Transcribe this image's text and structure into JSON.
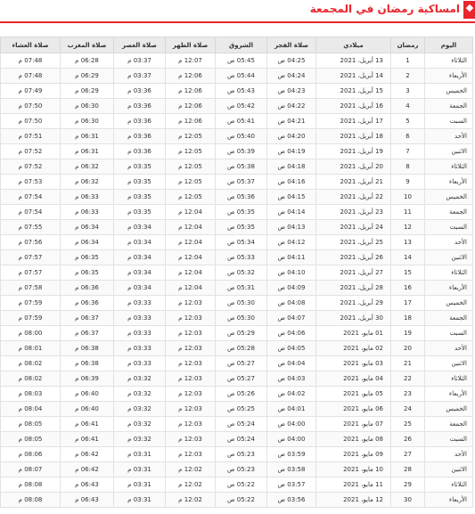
{
  "header": {
    "title": "امساكية رمضان في المجمعة",
    "flag_color": "#e9262c"
  },
  "table": {
    "columns": [
      "اليوم",
      "رمضان",
      "ميلادي",
      "صلاة الفجر",
      "الشروق",
      "صلاة الظهر",
      "صلاة العصر",
      "صلاة المغرب",
      "صلاة العشاء"
    ],
    "rows": [
      [
        "الثلاثاء",
        "1",
        "13 أبريل، 2021",
        "04:25 ص",
        "05:45 ص",
        "12:07 م",
        "03:37 م",
        "06:28 م",
        "07:48 م"
      ],
      [
        "الأربعاء",
        "2",
        "14 أبريل، 2021",
        "04:24 ص",
        "05:44 ص",
        "12:06 م",
        "03:37 م",
        "06:29 م",
        "07:48 م"
      ],
      [
        "الخميس",
        "3",
        "15 أبريل، 2021",
        "04:23 ص",
        "05:43 ص",
        "12:06 م",
        "03:36 م",
        "06:29 م",
        "07:49 م"
      ],
      [
        "الجمعة",
        "4",
        "16 أبريل، 2021",
        "04:22 ص",
        "05:42 ص",
        "12:06 م",
        "03:36 م",
        "06:30 م",
        "07:50 م"
      ],
      [
        "السبت",
        "5",
        "17 أبريل، 2021",
        "04:21 ص",
        "05:41 ص",
        "12:06 م",
        "03:36 م",
        "06:30 م",
        "07:50 م"
      ],
      [
        "الأحد",
        "6",
        "18 أبريل، 2021",
        "04:20 ص",
        "05:40 ص",
        "12:05 م",
        "03:36 م",
        "06:31 م",
        "07:51 م"
      ],
      [
        "الاثنين",
        "7",
        "19 أبريل، 2021",
        "04:19 ص",
        "05:39 ص",
        "12:05 م",
        "03:36 م",
        "06:31 م",
        "07:52 م"
      ],
      [
        "الثلاثاء",
        "8",
        "20 أبريل، 2021",
        "04:18 ص",
        "05:38 ص",
        "12:05 م",
        "03:35 م",
        "06:32 م",
        "07:52 م"
      ],
      [
        "الأربعاء",
        "9",
        "21 أبريل، 2021",
        "04:16 ص",
        "05:37 ص",
        "12:05 م",
        "03:35 م",
        "06:32 م",
        "07:53 م"
      ],
      [
        "الخميس",
        "10",
        "22 أبريل، 2021",
        "04:15 ص",
        "05:36 ص",
        "12:05 م",
        "03:35 م",
        "06:33 م",
        "07:54 م"
      ],
      [
        "الجمعة",
        "11",
        "23 أبريل، 2021",
        "04:14 ص",
        "05:35 ص",
        "12:04 م",
        "03:35 م",
        "06:33 م",
        "07:54 م"
      ],
      [
        "السبت",
        "12",
        "24 أبريل، 2021",
        "04:13 ص",
        "05:35 ص",
        "12:04 م",
        "03:34 م",
        "06:34 م",
        "07:55 م"
      ],
      [
        "الأحد",
        "13",
        "25 أبريل، 2021",
        "04:12 ص",
        "05:34 ص",
        "12:04 م",
        "03:34 م",
        "06:34 م",
        "07:56 م"
      ],
      [
        "الاثنين",
        "14",
        "26 أبريل، 2021",
        "04:11 ص",
        "05:33 ص",
        "12:04 م",
        "03:34 م",
        "06:35 م",
        "07:57 م"
      ],
      [
        "الثلاثاء",
        "15",
        "27 أبريل، 2021",
        "04:10 ص",
        "05:32 ص",
        "12:04 م",
        "03:34 م",
        "06:35 م",
        "07:57 م"
      ],
      [
        "الأربعاء",
        "16",
        "28 أبريل، 2021",
        "04:09 ص",
        "05:31 ص",
        "12:04 م",
        "03:34 م",
        "06:36 م",
        "07:58 م"
      ],
      [
        "الخميس",
        "17",
        "29 أبريل، 2021",
        "04:08 ص",
        "05:30 ص",
        "12:03 م",
        "03:33 م",
        "06:36 م",
        "07:59 م"
      ],
      [
        "الجمعة",
        "18",
        "30 أبريل، 2021",
        "04:07 ص",
        "05:30 ص",
        "12:03 م",
        "03:33 م",
        "06:37 م",
        "07:59 م"
      ],
      [
        "السبت",
        "19",
        "01 مايو، 2021",
        "04:06 ص",
        "05:29 ص",
        "12:03 م",
        "03:33 م",
        "06:37 م",
        "08:00 م"
      ],
      [
        "الأحد",
        "20",
        "02 مايو، 2021",
        "04:05 ص",
        "05:28 ص",
        "12:03 م",
        "03:33 م",
        "06:38 م",
        "08:01 م"
      ],
      [
        "الاثنين",
        "21",
        "03 مايو، 2021",
        "04:04 ص",
        "05:27 ص",
        "12:03 م",
        "03:33 م",
        "06:38 م",
        "08:02 م"
      ],
      [
        "الثلاثاء",
        "22",
        "04 مايو، 2021",
        "04:03 ص",
        "05:27 ص",
        "12:03 م",
        "03:32 م",
        "06:39 م",
        "08:02 م"
      ],
      [
        "الأربعاء",
        "23",
        "05 مايو، 2021",
        "04:02 ص",
        "05:26 ص",
        "12:03 م",
        "03:32 م",
        "06:40 م",
        "08:03 م"
      ],
      [
        "الخميس",
        "24",
        "06 مايو، 2021",
        "04:01 ص",
        "05:25 ص",
        "12:03 م",
        "03:32 م",
        "06:40 م",
        "08:04 م"
      ],
      [
        "الجمعة",
        "25",
        "07 مايو، 2021",
        "04:00 ص",
        "05:24 ص",
        "12:03 م",
        "03:32 م",
        "06:41 م",
        "08:05 م"
      ],
      [
        "السبت",
        "26",
        "08 مايو، 2021",
        "04:00 ص",
        "05:24 ص",
        "12:03 م",
        "03:32 م",
        "06:41 م",
        "08:05 م"
      ],
      [
        "الأحد",
        "27",
        "09 مايو، 2021",
        "03:59 ص",
        "05:23 ص",
        "12:03 م",
        "03:31 م",
        "06:42 م",
        "08:06 م"
      ],
      [
        "الاثنين",
        "28",
        "10 مايو، 2021",
        "03:58 ص",
        "05:23 ص",
        "12:02 م",
        "03:31 م",
        "06:42 م",
        "08:07 م"
      ],
      [
        "الثلاثاء",
        "29",
        "11 مايو، 2021",
        "03:57 ص",
        "05:22 ص",
        "12:02 م",
        "03:31 م",
        "06:43 م",
        "08:08 م"
      ],
      [
        "الأربعاء",
        "30",
        "12 مايو، 2021",
        "03:56 ص",
        "05:22 ص",
        "12:02 م",
        "03:31 م",
        "06:43 م",
        "08:08 م"
      ]
    ]
  }
}
